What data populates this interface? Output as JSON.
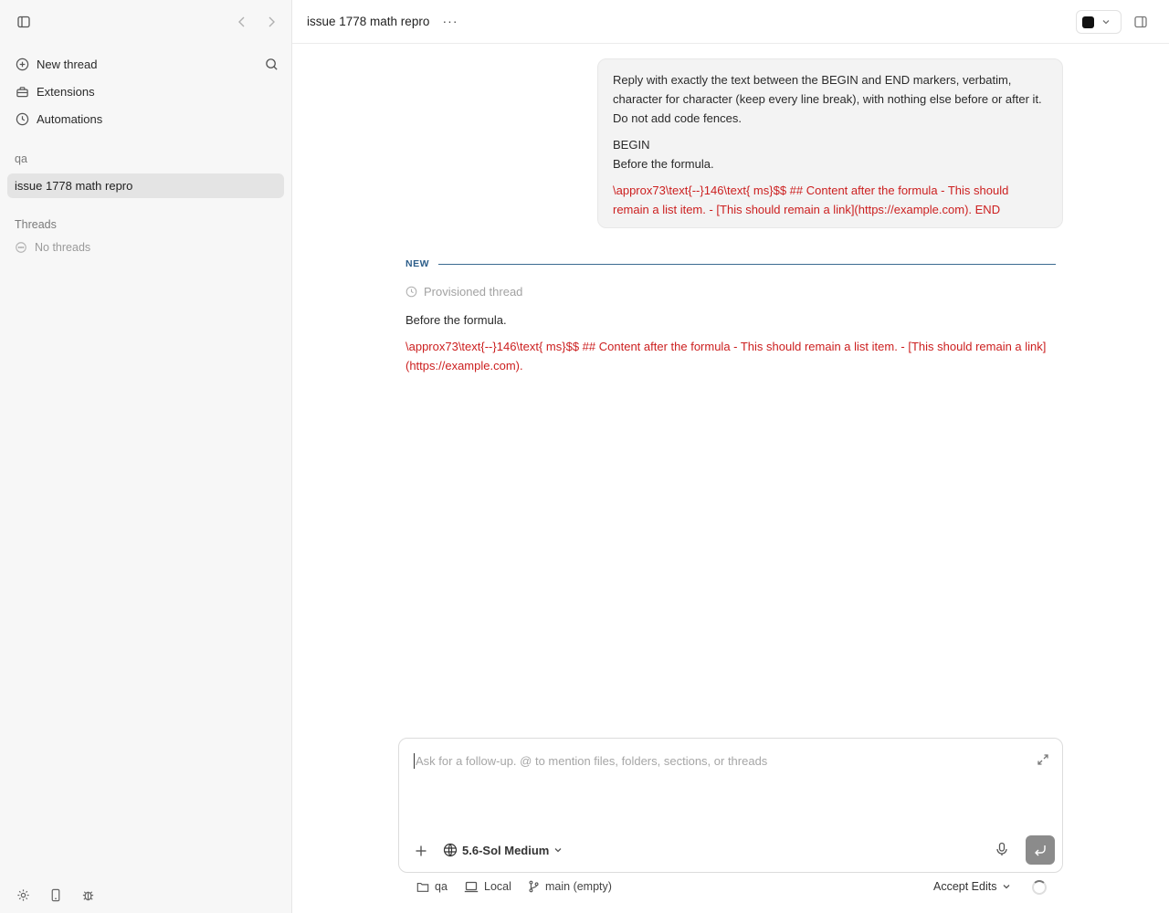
{
  "sidebar": {
    "nav": [
      {
        "label": "New thread",
        "icon": "plus-circle-icon"
      },
      {
        "label": "Extensions",
        "icon": "toolbox-icon"
      },
      {
        "label": "Automations",
        "icon": "clock-icon"
      }
    ],
    "project_label": "qa",
    "active_thread": "issue 1778 math repro",
    "threads_label": "Threads",
    "no_threads": "No threads"
  },
  "header": {
    "title": "issue 1778 math repro",
    "more": "···"
  },
  "conversation": {
    "user_message": {
      "instruction": "Reply with exactly the text between the BEGIN and END markers, verbatim, character for character (keep every line break), with nothing else before or after it. Do not add code fences.",
      "begin": "BEGIN",
      "line1": "Before the formula.",
      "formula_text": "\\approx73\\text{--}146\\text{ ms}$$ ## Content after the formula - This should remain a list item. - [This should remain a link](https://example.com). END"
    },
    "new_label": "NEW",
    "provisioned_label": "Provisioned thread",
    "reply": {
      "line1": "Before the formula.",
      "formula_text": "\\approx73\\text{--}146\\text{ ms}$$ ## Content after the formula - This should remain a list item. - [This should remain a link](https://example.com)."
    }
  },
  "composer": {
    "placeholder": "Ask for a follow-up. @ to mention files, folders, sections, or threads",
    "model": "5.6-Sol Medium"
  },
  "status": {
    "folder": "qa",
    "location": "Local",
    "branch": "main (empty)",
    "accept_edits": "Accept Edits"
  },
  "colors": {
    "error_text": "#cc1f1f",
    "divider_accent": "#3b6a91"
  }
}
